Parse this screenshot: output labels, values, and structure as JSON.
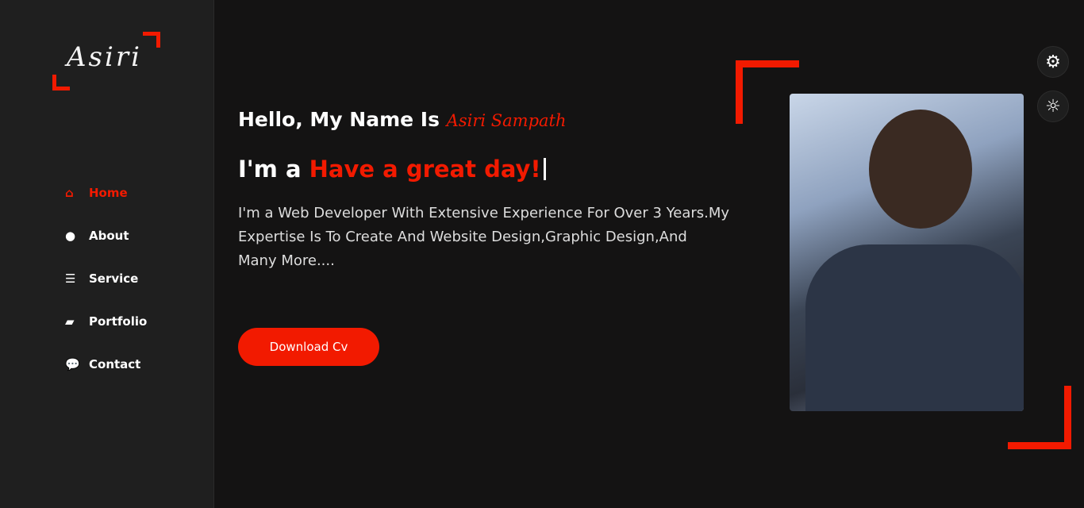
{
  "logo": {
    "text": "Asiri"
  },
  "nav": [
    {
      "label": "Home",
      "icon": "home-icon"
    },
    {
      "label": "About",
      "icon": "user-icon"
    },
    {
      "label": "Service",
      "icon": "list-icon"
    },
    {
      "label": "Portfolio",
      "icon": "briefcase-icon"
    },
    {
      "label": "Contact",
      "icon": "comments-icon"
    }
  ],
  "hero": {
    "greeting": "Hello, My Name Is ",
    "name": "Asiri Sampath",
    "im_prefix": "I'm a ",
    "typed": "Have a great day!",
    "description": "I'm a Web Developer With Extensive Experience For Over 3 Years.My Expertise Is To Create And Website Design,Graphic Design,And Many More....",
    "button": "Download Cv"
  },
  "colors": {
    "accent": "#f21a00",
    "background": "#141313",
    "sidebar": "#1f1f1f"
  }
}
